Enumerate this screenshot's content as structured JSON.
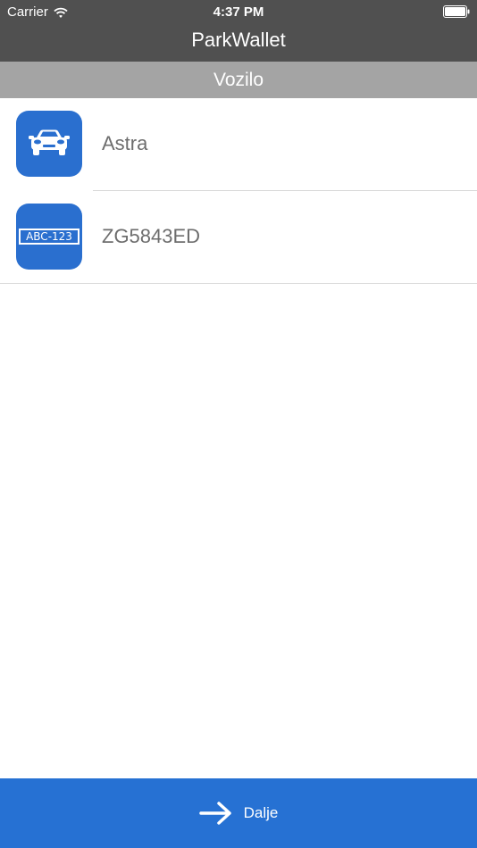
{
  "status_bar": {
    "carrier": "Carrier",
    "time": "4:37 PM",
    "wifi_icon": "wifi-icon",
    "battery_icon": "battery-icon"
  },
  "nav": {
    "title": "ParkWallet"
  },
  "section": {
    "title": "Vozilo"
  },
  "vehicle_items": [
    {
      "label": "Astra",
      "icon": "car-icon"
    },
    {
      "label": "ZG5843ED",
      "icon": "license-plate-icon",
      "icon_text": "ABC-123"
    }
  ],
  "footer": {
    "label": "Dalje",
    "icon": "arrow-right-icon"
  },
  "colors": {
    "bar_background": "#505050",
    "section_background": "#a4a4a4",
    "accent": "#2671d3",
    "icon_tile": "#2a6fcf",
    "item_text": "#6d6d6d",
    "separator": "#d9d9d9"
  }
}
